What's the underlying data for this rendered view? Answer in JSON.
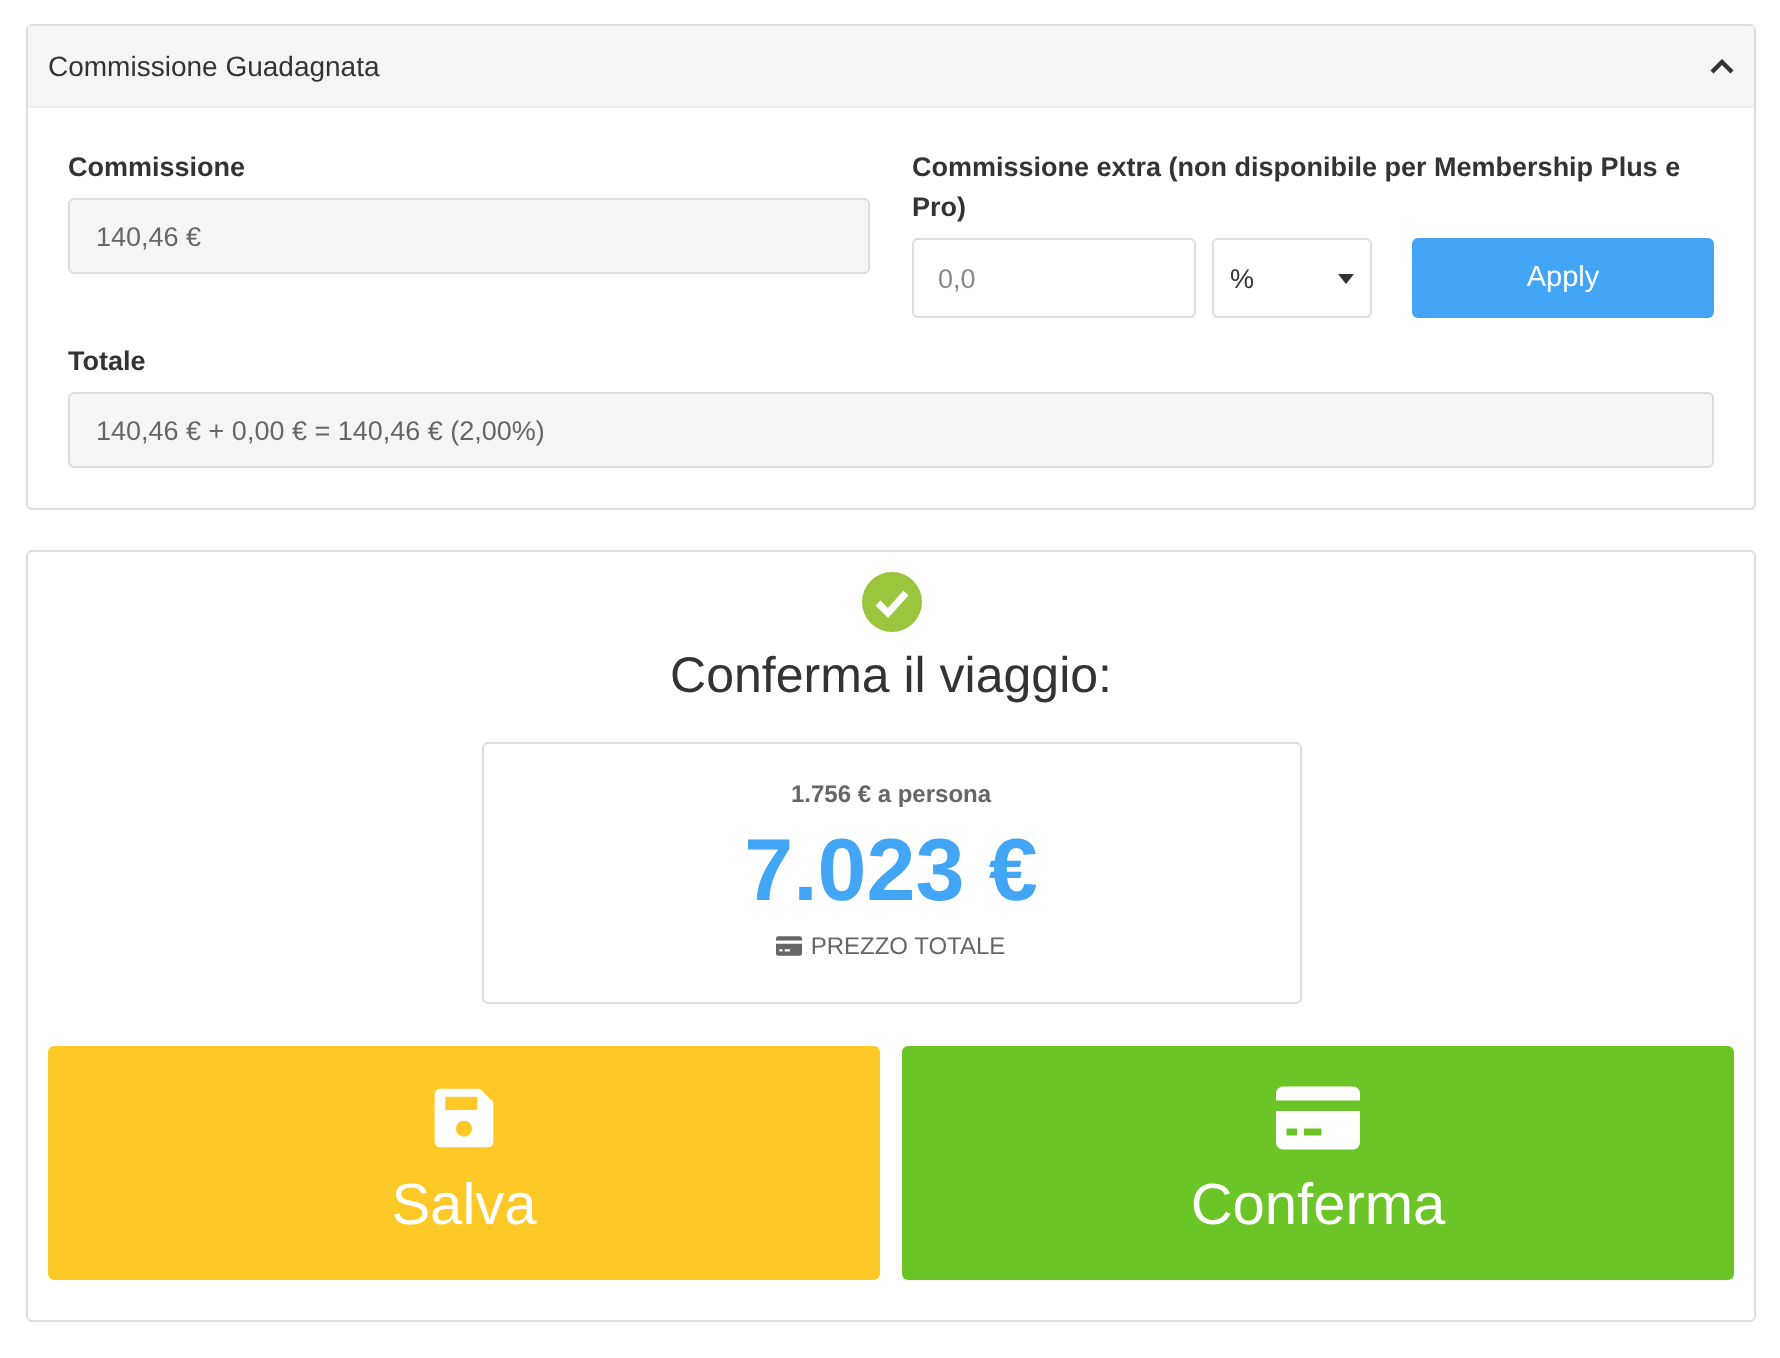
{
  "commission_panel": {
    "title": "Commissione Guadagnata",
    "expanded": true,
    "commission": {
      "label": "Commissione",
      "value": "140,46 €"
    },
    "extra": {
      "label": "Commissione extra (non disponibile per Membership Plus e Pro)",
      "placeholder": "0,0",
      "unit": "%",
      "button": "Apply"
    },
    "total": {
      "label": "Totale",
      "value": "140,46 € + 0,00 € = 140,46 € (2,00%)"
    }
  },
  "confirm_panel": {
    "title": "Conferma il viaggio:",
    "price": {
      "per_person": "1.756 € a persona",
      "total": "7.023 €",
      "caption": "PREZZO TOTALE"
    },
    "buttons": [
      {
        "kind": "save",
        "label": "Salva"
      },
      {
        "kind": "confirm",
        "label": "Conferma"
      }
    ]
  }
}
